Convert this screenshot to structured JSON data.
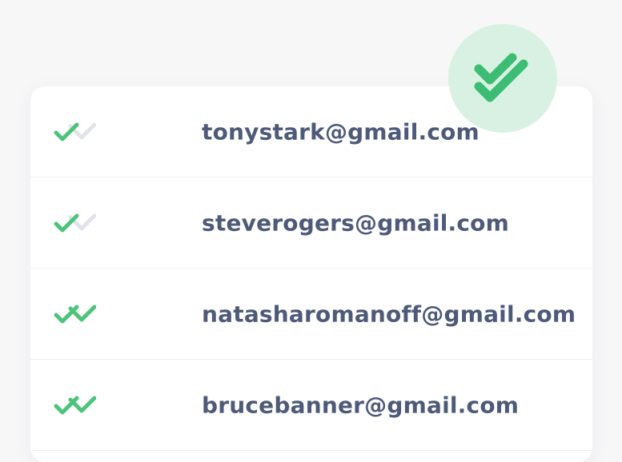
{
  "status_badge": {
    "icon": "double-check-icon",
    "background_color": "#d9f1e2",
    "icon_color": "#3dbd73"
  },
  "emails": [
    {
      "address": "tonystark@gmail.com",
      "status": "single-check",
      "status_icon": "single-check-icon"
    },
    {
      "address": "steverogers@gmail.com",
      "status": "single-check",
      "status_icon": "single-check-icon"
    },
    {
      "address": "natasharomanoff@gmail.com",
      "status": "double-check",
      "status_icon": "double-check-icon"
    },
    {
      "address": "brucebanner@gmail.com",
      "status": "double-check",
      "status_icon": "double-check-icon"
    }
  ],
  "colors": {
    "check_active": "#4cc47a",
    "check_inactive": "#e0e3e8",
    "email_text": "#4d5a79"
  }
}
